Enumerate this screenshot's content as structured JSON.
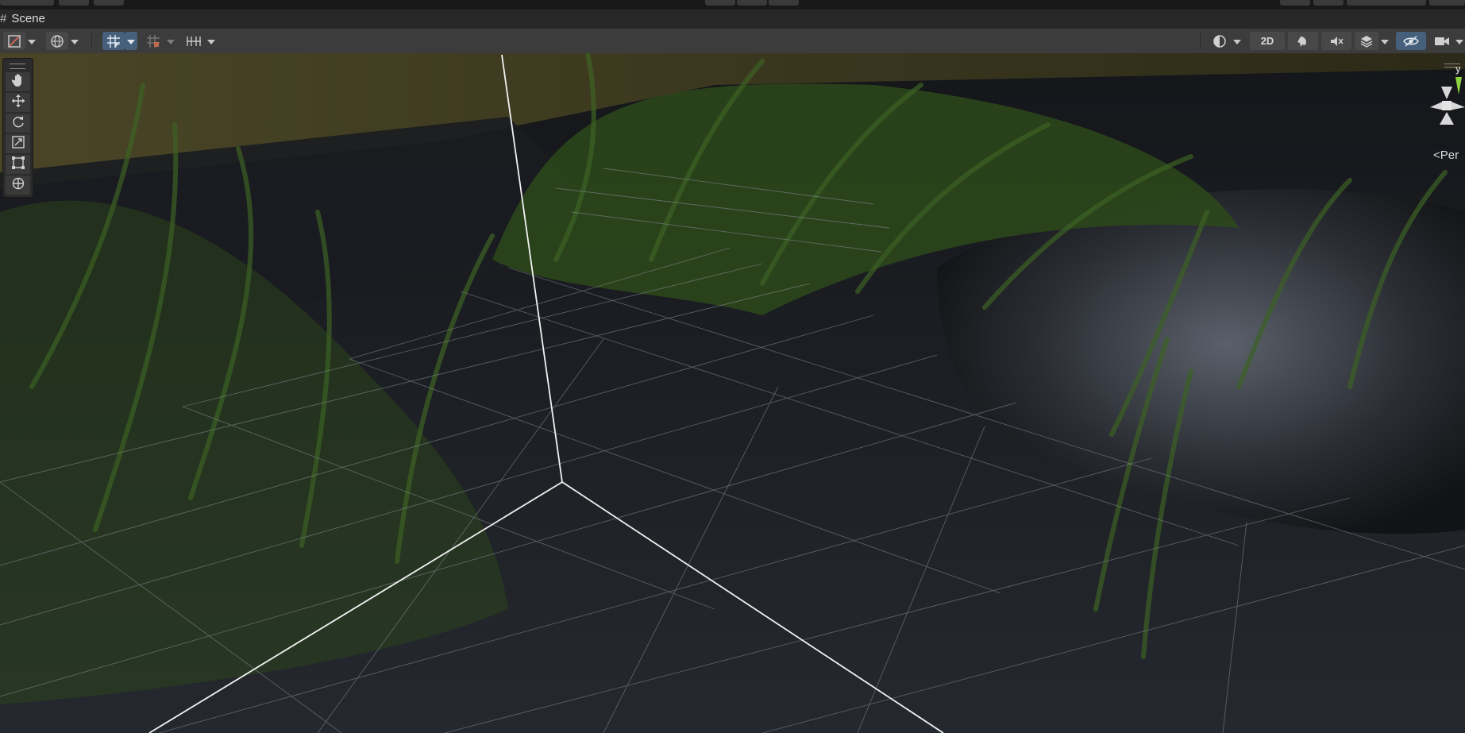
{
  "window": {
    "panel_title": "Scene"
  },
  "toolbar": {
    "left": [
      {
        "name": "draw-mode",
        "icon": "shading-mode-icon"
      },
      {
        "name": "global-local-toggle",
        "icon": "globe-icon"
      },
      {
        "name": "grid-snapping",
        "icon": "grid-snap-icon",
        "active": true
      },
      {
        "name": "increment-snapping",
        "icon": "increment-snap-icon"
      },
      {
        "name": "grid-visibility",
        "icon": "grid-visibility-icon"
      }
    ],
    "right": {
      "shading": "sphere-shading-icon",
      "mode_2d_label": "2D",
      "lighting": "lighting-icon",
      "audio": "audio-mute-icon",
      "effects": "effects-icon",
      "visibility": "visibility-eye-icon",
      "camera": "camera-icon"
    }
  },
  "tools": [
    {
      "name": "hand-tool",
      "icon": "hand-icon"
    },
    {
      "name": "move-tool",
      "icon": "move-arrows-icon"
    },
    {
      "name": "rotate-tool",
      "icon": "rotate-icon"
    },
    {
      "name": "scale-tool",
      "icon": "scale-icon"
    },
    {
      "name": "rect-tool",
      "icon": "rect-transform-icon"
    },
    {
      "name": "transform-tool",
      "icon": "transform-icon"
    }
  ],
  "gizmo": {
    "axis_label": "y",
    "projection_label": "<Per",
    "y_axis_color": "#8bd43f"
  },
  "colors": {
    "toolbar_bg": "#3c3c3c",
    "active_button": "#46607c",
    "grass": "#2f4a1c",
    "water": "#22252b"
  }
}
